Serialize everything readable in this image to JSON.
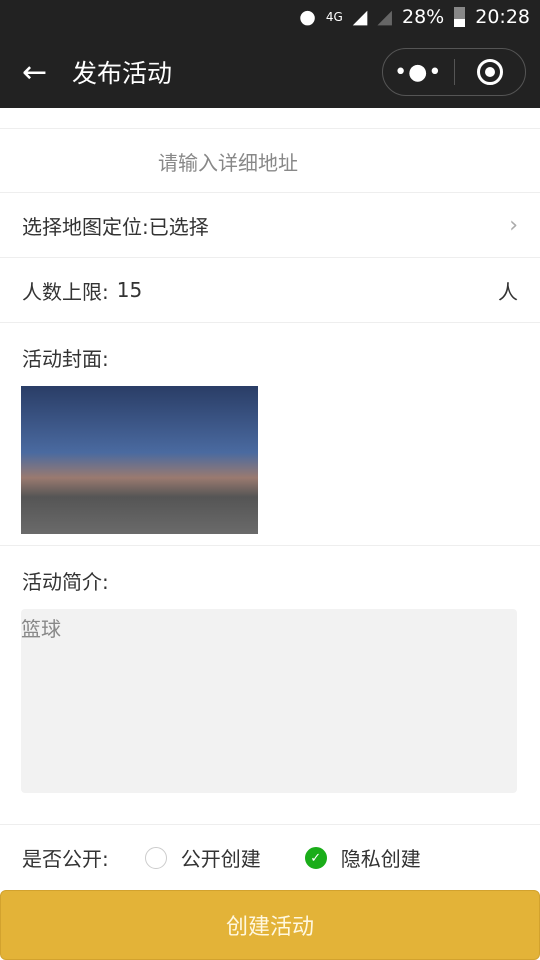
{
  "status": {
    "battery": "28%",
    "time": "20:28",
    "network": "4G"
  },
  "header": {
    "title": "发布活动"
  },
  "form": {
    "address_placeholder": "请输入详细地址",
    "map_label": "选择地图定位:已选择",
    "limit_label": "人数上限:",
    "limit_value": "15",
    "limit_unit": "人",
    "cover_label": "活动封面:",
    "intro_label": "活动简介:",
    "intro_value": "篮球",
    "public_label": "是否公开:",
    "option_public": "公开创建",
    "option_private": "隐私创建",
    "selected": "隐私创建"
  },
  "submit_label": "创建活动",
  "colors": {
    "accent": "#e3b338",
    "check": "#1aad19"
  }
}
